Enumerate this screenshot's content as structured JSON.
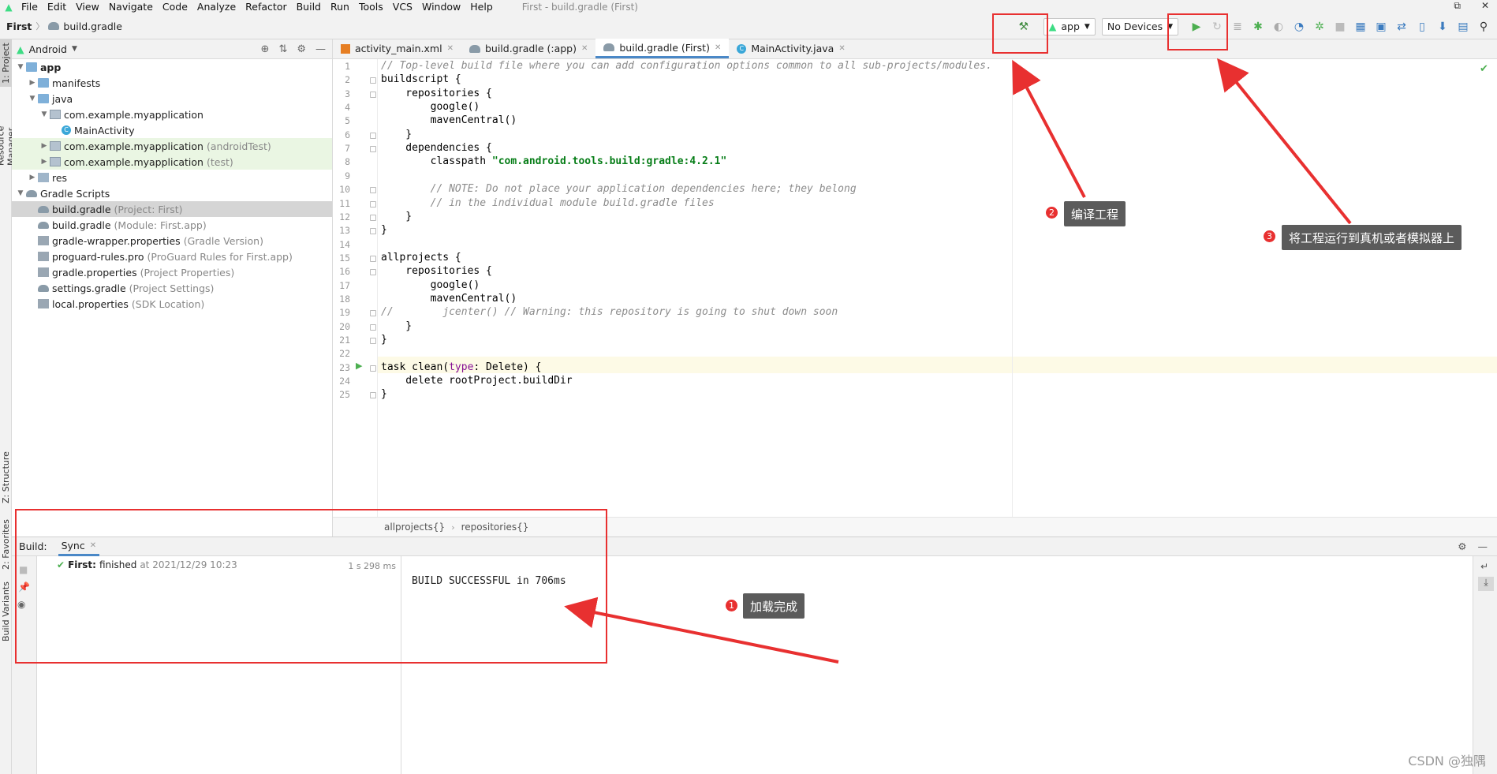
{
  "app": {
    "window_title": "First - build.gradle (First)",
    "menu": [
      "File",
      "Edit",
      "View",
      "Navigate",
      "Code",
      "Analyze",
      "Refactor",
      "Build",
      "Run",
      "Tools",
      "VCS",
      "Window",
      "Help"
    ]
  },
  "nav": {
    "project": "First",
    "file": "build.gradle"
  },
  "toolbar": {
    "run_config": "app",
    "device": "No Devices",
    "hammer_icon": "hammer-icon",
    "run_icon": "run-icon"
  },
  "left_strip": {
    "project_tab": "1: Project",
    "resource_tab": "Resource Manager",
    "structure_tab": "Z: Structure",
    "favorites_tab": "2: Favorites",
    "variants_tab": "Build Variants"
  },
  "project_panel": {
    "view_mode": "Android",
    "tree": [
      {
        "label": "app",
        "extra": "",
        "indent": 0,
        "arrow": "down",
        "icon": "folder",
        "bold": true,
        "style": ""
      },
      {
        "label": "manifests",
        "extra": "",
        "indent": 1,
        "arrow": "right",
        "icon": "folder",
        "bold": false,
        "style": ""
      },
      {
        "label": "java",
        "extra": "",
        "indent": 1,
        "arrow": "down",
        "icon": "folder",
        "bold": false,
        "style": ""
      },
      {
        "label": "com.example.myapplication",
        "extra": "",
        "indent": 2,
        "arrow": "down",
        "icon": "pkg",
        "bold": false,
        "style": ""
      },
      {
        "label": "MainActivity",
        "extra": "",
        "indent": 3,
        "arrow": "",
        "icon": "cls",
        "bold": false,
        "style": ""
      },
      {
        "label": "com.example.myapplication",
        "extra": "(androidTest)",
        "indent": 2,
        "arrow": "right",
        "icon": "pkg",
        "bold": false,
        "style": "green"
      },
      {
        "label": "com.example.myapplication",
        "extra": "(test)",
        "indent": 2,
        "arrow": "right",
        "icon": "pkg",
        "bold": false,
        "style": "green"
      },
      {
        "label": "res",
        "extra": "",
        "indent": 1,
        "arrow": "right",
        "icon": "res",
        "bold": false,
        "style": ""
      },
      {
        "label": "Gradle Scripts",
        "extra": "",
        "indent": 0,
        "arrow": "down",
        "icon": "grd",
        "bold": false,
        "style": ""
      },
      {
        "label": "build.gradle",
        "extra": "(Project: First)",
        "indent": 1,
        "arrow": "",
        "icon": "grd",
        "bold": false,
        "style": "selrow"
      },
      {
        "label": "build.gradle",
        "extra": "(Module: First.app)",
        "indent": 1,
        "arrow": "",
        "icon": "grd",
        "bold": false,
        "style": ""
      },
      {
        "label": "gradle-wrapper.properties",
        "extra": "(Gradle Version)",
        "indent": 1,
        "arrow": "",
        "icon": "prop",
        "bold": false,
        "style": ""
      },
      {
        "label": "proguard-rules.pro",
        "extra": "(ProGuard Rules for First.app)",
        "indent": 1,
        "arrow": "",
        "icon": "prop",
        "bold": false,
        "style": ""
      },
      {
        "label": "gradle.properties",
        "extra": "(Project Properties)",
        "indent": 1,
        "arrow": "",
        "icon": "prop",
        "bold": false,
        "style": ""
      },
      {
        "label": "settings.gradle",
        "extra": "(Project Settings)",
        "indent": 1,
        "arrow": "",
        "icon": "grd",
        "bold": false,
        "style": ""
      },
      {
        "label": "local.properties",
        "extra": "(SDK Location)",
        "indent": 1,
        "arrow": "",
        "icon": "prop",
        "bold": false,
        "style": ""
      }
    ]
  },
  "editor": {
    "tabs": [
      {
        "label": "activity_main.xml",
        "icon": "xml",
        "active": false
      },
      {
        "label": "build.gradle (:app)",
        "icon": "gradle",
        "active": false
      },
      {
        "label": "build.gradle (First)",
        "icon": "gradle",
        "active": true
      },
      {
        "label": "MainActivity.java",
        "icon": "java",
        "active": false
      }
    ],
    "lines": [
      "// Top-level build file where you can add configuration options common to all sub-projects/modules.",
      "buildscript {",
      "    repositories {",
      "        google()",
      "        mavenCentral()",
      "    }",
      "    dependencies {",
      "        classpath \"com.android.tools.build:gradle:4.2.1\"",
      "",
      "        // NOTE: Do not place your application dependencies here; they belong",
      "        // in the individual module build.gradle files",
      "    }",
      "}",
      "",
      "allprojects {",
      "    repositories {",
      "        google()",
      "        mavenCentral()",
      "//        jcenter() // Warning: this repository is going to shut down soon",
      "    }",
      "}",
      "",
      "task clean(type: Delete) {",
      "    delete rootProject.buildDir",
      "}"
    ],
    "breadcrumb": [
      "allprojects{}",
      "repositories{}"
    ]
  },
  "build": {
    "label": "Build:",
    "tab": "Sync",
    "tree_item_name": "First:",
    "tree_item_status": "finished",
    "tree_item_time": "at 2021/12/29 10:23",
    "duration": "1 s 298 ms",
    "output": "BUILD SUCCESSFUL in 706ms"
  },
  "annotations": {
    "n1": "1",
    "t1": "加载完成",
    "n2": "2",
    "t2": "编译工程",
    "n3": "3",
    "t3": "将工程运行到真机或者模拟器上",
    "accent": "#e83030"
  },
  "watermark": "CSDN @独隅"
}
